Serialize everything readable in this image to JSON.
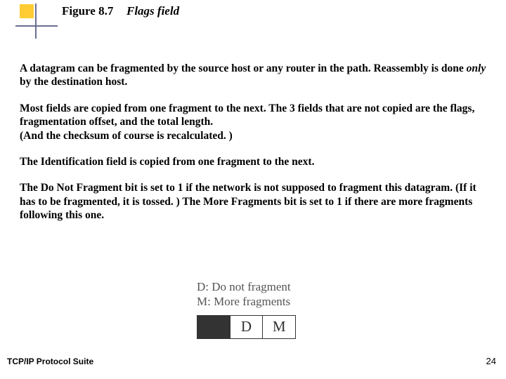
{
  "header": {
    "figure_label": "Figure 8.7",
    "figure_title": "Flags field"
  },
  "body": {
    "p1_a": "A datagram can be fragmented by the source host or any router in the path.  Reassembly is done ",
    "p1_only": "only",
    "p1_b": " by the destination host.",
    "p2": "Most fields are copied from one fragment to the next.  The 3 fields that are not copied are the flags, fragmentation offset, and the total length.\n(And the checksum of course is recalculated. )",
    "p3": "The Identification field is copied from one fragment to the next.",
    "p4": "The Do Not Fragment bit is set to 1 if the network is not supposed to fragment this datagram.  (If it has to be fragmented, it is tossed. )  The More Fragments bit is set to 1 if there are more fragments following this one."
  },
  "flags": {
    "line1": "D: Do not fragment",
    "line2": "M: More fragments",
    "cell_d": "D",
    "cell_m": "M"
  },
  "footer": {
    "left": "TCP/IP Protocol Suite",
    "page": "24"
  }
}
